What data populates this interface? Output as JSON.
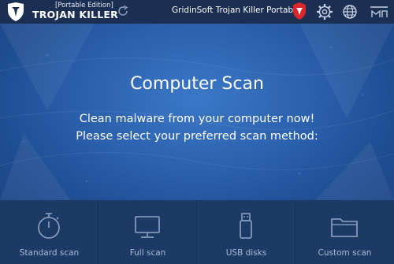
{
  "header": {
    "edition": "[Portable Edition]",
    "brand": "TROJAN KILLER",
    "app_title": "GridinSoft Trojan Killer Portable",
    "icons": [
      "shield-logo-icon",
      "refresh-icon",
      "gridinsoft-logo-icon",
      "gear-icon",
      "globe-icon",
      "window-controls-icon"
    ]
  },
  "hero": {
    "title": "Computer Scan",
    "line1": "Clean malware from your computer now!",
    "line2": "Please select your preferred scan method:"
  },
  "scan_options": [
    {
      "label": "Standard scan",
      "icon": "stopwatch-icon"
    },
    {
      "label": "Full scan",
      "icon": "monitor-icon"
    },
    {
      "label": "USB disks",
      "icon": "usb-drive-icon"
    },
    {
      "label": "Custom scan",
      "icon": "folder-icon"
    }
  ],
  "colors": {
    "topbar": "#1a2f52",
    "hero": "#2a5fab",
    "bottom": "#1c3a66",
    "label": "#a9bbd4",
    "accent_red": "#d8282b"
  }
}
